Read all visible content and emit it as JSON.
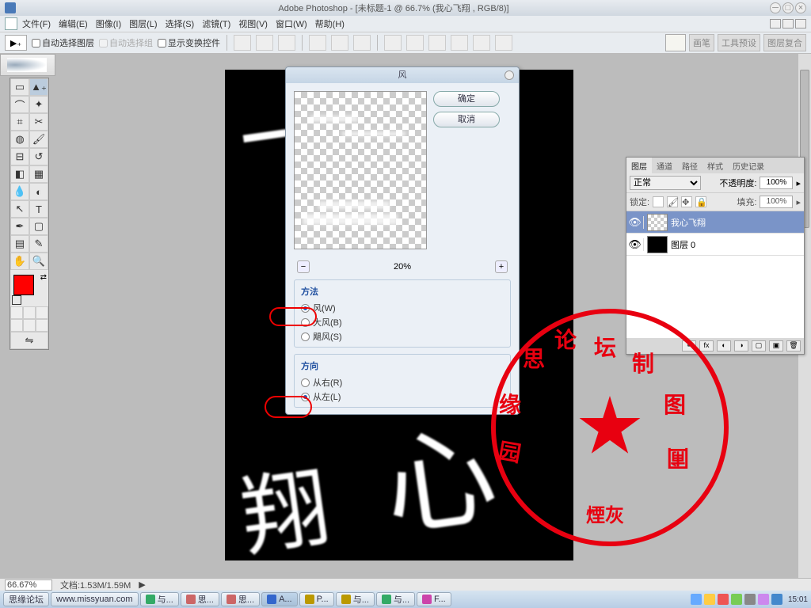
{
  "titlebar": {
    "app": "Adobe Photoshop",
    "doc": "[未标题-1 @ 66.7% (我心飞翔 , RGB/8)]"
  },
  "menu": {
    "file": "文件(F)",
    "edit": "编辑(E)",
    "image": "图像(I)",
    "layer": "图层(L)",
    "select": "选择(S)",
    "filter": "滤镜(T)",
    "view": "视图(V)",
    "window": "窗口(W)",
    "help": "帮助(H)"
  },
  "options": {
    "auto_select_layer": "自动选择图层",
    "auto_select_group": "自动选择组",
    "show_transform": "显示变换控件",
    "brush": "画笔",
    "tool_presets": "工具预设",
    "layer_comps": "图层复合"
  },
  "dialog": {
    "title": "风",
    "ok": "确定",
    "cancel": "取消",
    "zoom_pct": "20%",
    "zoom_out": "−",
    "zoom_in": "+",
    "method_title": "方法",
    "method": {
      "wind": "风(W)",
      "blast": "大风(B)",
      "stagger": "飓风(S)"
    },
    "direction_title": "方向",
    "direction": {
      "right": "从右(R)",
      "left": "从左(L)"
    }
  },
  "layers_panel": {
    "tabs": {
      "layers": "图层",
      "channels": "通道",
      "paths": "路径",
      "styles": "样式",
      "history": "历史记录"
    },
    "blend": "正常",
    "opacity_label": "不透明度:",
    "opacity": "100%",
    "lock_label": "锁定:",
    "fill_label": "填充:",
    "fill": "100%",
    "layer1": "我心飞翔",
    "layer0": "图层 0"
  },
  "status": {
    "zoom": "66.67%",
    "docinfo": "文档:1.53M/1.59M"
  },
  "taskbar": {
    "items": [
      "思缘论坛",
      "www.missyuan.com",
      "与...",
      "思...",
      "思...",
      "A...",
      "P...",
      "与...",
      "与...",
      "F..."
    ],
    "clock": "15:01"
  },
  "stamp": {
    "circ": "思缘论坛制图园圃",
    "sig": "煙灰"
  }
}
